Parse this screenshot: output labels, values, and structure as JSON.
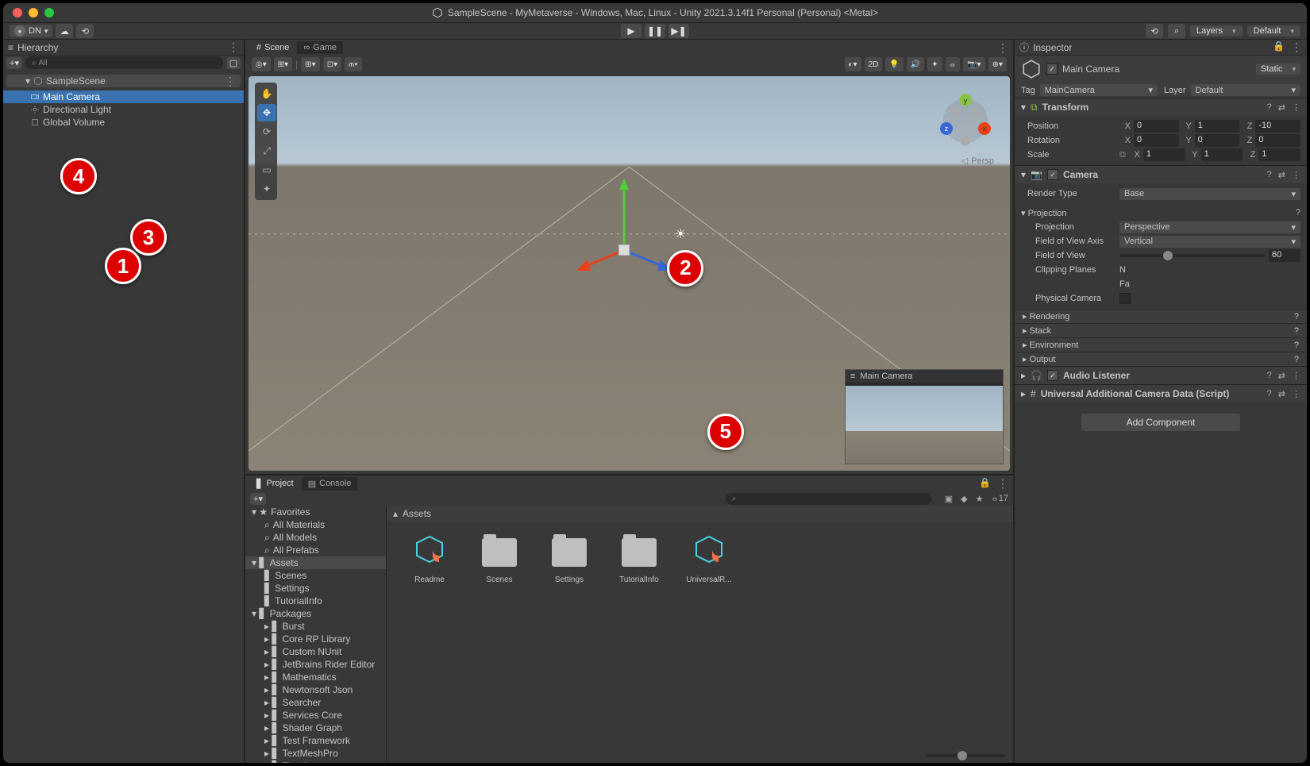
{
  "window_title": "SampleScene - MyMetaverse - Windows, Mac, Linux - Unity 2021.3.14f1 Personal (Personal) <Metal>",
  "account_initials": "DN",
  "layers_label": "Layers",
  "layout_label": "Default",
  "hierarchy": {
    "title": "Hierarchy",
    "search_placeholder": "All",
    "scene": "SampleScene",
    "items": [
      "Main Camera",
      "Directional Light",
      "Global Volume"
    ]
  },
  "scene_tab": "Scene",
  "game_tab": "Game",
  "scene_toolbar": {
    "btn_2d": "2D"
  },
  "persp_label": "Persp",
  "cam_preview_label": "Main Camera",
  "inspector": {
    "title": "Inspector",
    "object_name": "Main Camera",
    "static_label": "Static",
    "tag_label": "Tag",
    "tag_value": "MainCamera",
    "layer_label": "Layer",
    "layer_value": "Default",
    "transform": {
      "title": "Transform",
      "pos_lbl": "Position",
      "rot_lbl": "Rotation",
      "scl_lbl": "Scale",
      "pos": {
        "x": "0",
        "y": "1",
        "z": "-10"
      },
      "rot": {
        "x": "0",
        "y": "0",
        "z": "0"
      },
      "scl": {
        "x": "1",
        "y": "1",
        "z": "1"
      }
    },
    "camera": {
      "title": "Camera",
      "render_type_lbl": "Render Type",
      "render_type": "Base",
      "projection_sect": "Projection",
      "projection_lbl": "Projection",
      "projection": "Perspective",
      "fov_axis_lbl": "Field of View Axis",
      "fov_axis": "Vertical",
      "fov_lbl": "Field of View",
      "fov": "60",
      "clip_lbl": "Clipping Planes",
      "clip_near_lbl": "N",
      "clip_far_lbl": "Fa",
      "phys_lbl": "Physical Camera",
      "rendering": "Rendering",
      "stack": "Stack",
      "environment": "Environment",
      "output": "Output"
    },
    "audio_listener": "Audio Listener",
    "urp_data": "Universal Additional Camera Data (Script)",
    "add_component": "Add Component"
  },
  "project": {
    "tab_project": "Project",
    "tab_console": "Console",
    "fav": "Favorites",
    "fav_items": [
      "All Materials",
      "All Models",
      "All Prefabs"
    ],
    "assets": "Assets",
    "assets_items": [
      "Scenes",
      "Settings",
      "TutorialInfo"
    ],
    "packages": "Packages",
    "pkg_items": [
      "Burst",
      "Core RP Library",
      "Custom NUnit",
      "JetBrains Rider Editor",
      "Mathematics",
      "Newtonsoft Json",
      "Searcher",
      "Services Core",
      "Shader Graph",
      "Test Framework",
      "TextMeshPro",
      "Timeline"
    ],
    "crumb": "Assets",
    "grid_items": [
      "Readme",
      "Scenes",
      "Settings",
      "TutorialInfo",
      "UniversalR..."
    ],
    "hidden_count": "17"
  },
  "callouts": {
    "c1": "1",
    "c2": "2",
    "c3": "3",
    "c4": "4",
    "c5": "5"
  }
}
